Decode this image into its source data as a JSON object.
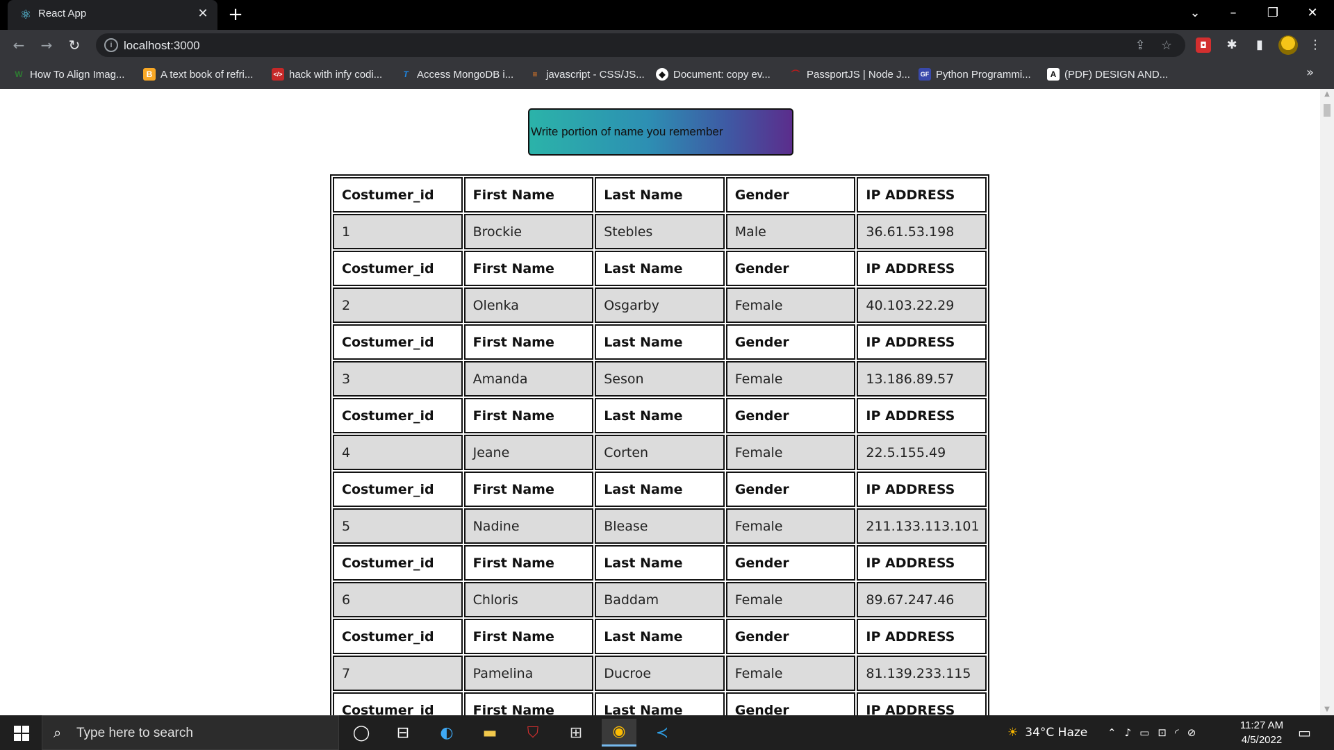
{
  "browser": {
    "tab_title": "React App",
    "url": "localhost:3000",
    "bookmarks": [
      {
        "label": "How To Align Imag...",
        "icon": "w-icon",
        "color": "#2e7d32"
      },
      {
        "label": "A text book of refri...",
        "icon": "book-icon",
        "color": "#f9a825"
      },
      {
        "label": "hack with infy codi...",
        "icon": "code-icon",
        "color": "#c62828"
      },
      {
        "label": "Access MongoDB i...",
        "icon": "t-icon",
        "color": "#1e88e5"
      },
      {
        "label": "javascript - CSS/JS...",
        "icon": "stackoverflow-icon",
        "color": "#f48024"
      },
      {
        "label": "Document: copy ev...",
        "icon": "chat-icon",
        "color": "#ffffff"
      },
      {
        "label": "PassportJS | Node J...",
        "icon": "passport-icon",
        "color": "#b71c1c"
      },
      {
        "label": "Python Programmi...",
        "icon": "python-icon",
        "color": "#3949ab"
      },
      {
        "label": "(PDF) DESIGN AND...",
        "icon": "a-icon",
        "color": "#ffffff"
      }
    ]
  },
  "search": {
    "placeholder": "Write portion of name you remember",
    "value": ""
  },
  "table": {
    "headers": [
      "Costumer_id",
      "First Name",
      "Last Name",
      "Gender",
      "IP ADDRESS"
    ],
    "rows": [
      [
        "1",
        "Brockie",
        "Stebles",
        "Male",
        "36.61.53.198"
      ],
      [
        "2",
        "Olenka",
        "Osgarby",
        "Female",
        "40.103.22.29"
      ],
      [
        "3",
        "Amanda",
        "Seson",
        "Female",
        "13.186.89.57"
      ],
      [
        "4",
        "Jeane",
        "Corten",
        "Female",
        "22.5.155.49"
      ],
      [
        "5",
        "Nadine",
        "Blease",
        "Female",
        "211.133.113.101"
      ],
      [
        "6",
        "Chloris",
        "Baddam",
        "Female",
        "89.67.247.46"
      ],
      [
        "7",
        "Pamelina",
        "Ducroe",
        "Female",
        "81.139.233.115"
      ]
    ],
    "partial_header": [
      "Costumer_id",
      "First Name",
      "Last Name",
      "Gender",
      "IP ADDRESS"
    ]
  },
  "taskbar": {
    "search_placeholder": "Type here to search",
    "weather": "34°C  Haze",
    "time": "11:27 AM",
    "date": "4/5/2022"
  },
  "colors": {
    "search_gradient": [
      "#2bb3a9",
      "#3e5aa4",
      "#5b2d8c"
    ],
    "row_bg": "#dcdcdc"
  }
}
